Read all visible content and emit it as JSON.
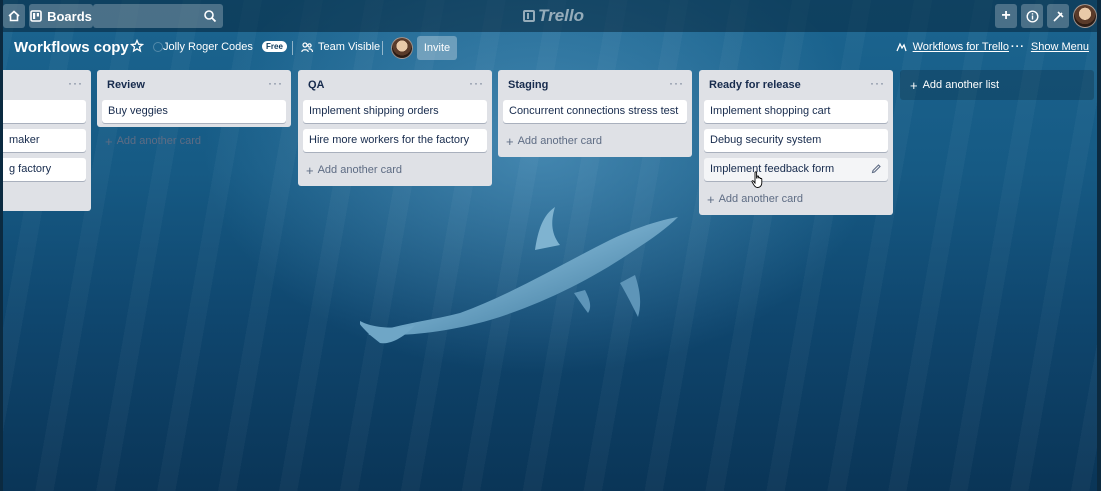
{
  "topbar": {
    "boards_label": "Boards",
    "logo_text": "Trello",
    "search_placeholder": ""
  },
  "board": {
    "title": "Workflows copy",
    "team_name": "Jolly Roger Codes",
    "team_badge": "Free",
    "visibility_label": "Team Visible",
    "invite_label": "Invite",
    "workflows_link": "Workflows for Trello",
    "menu_label": "Show Menu"
  },
  "lists": [
    {
      "title": "",
      "cards": [
        "",
        "maker",
        "g factory"
      ],
      "add_card_label": ""
    },
    {
      "title": "Review",
      "cards": [
        "Buy veggies"
      ],
      "add_card_label": "Add another card"
    },
    {
      "title": "QA",
      "cards": [
        "Implement shipping orders",
        "Hire more workers for the factory"
      ],
      "add_card_label": "Add another card"
    },
    {
      "title": "Staging",
      "cards": [
        "Concurrent connections stress test"
      ],
      "add_card_label": "Add another card"
    },
    {
      "title": "Ready for release",
      "cards": [
        "Implement shopping cart",
        "Debug security system",
        "Implement feedback form"
      ],
      "add_card_label": "Add another card"
    }
  ],
  "add_list_label": "Add another list",
  "colors": {
    "list_bg": "#dfe1e6",
    "card_bg": "#ffffff",
    "board_bg": "#165a84"
  }
}
